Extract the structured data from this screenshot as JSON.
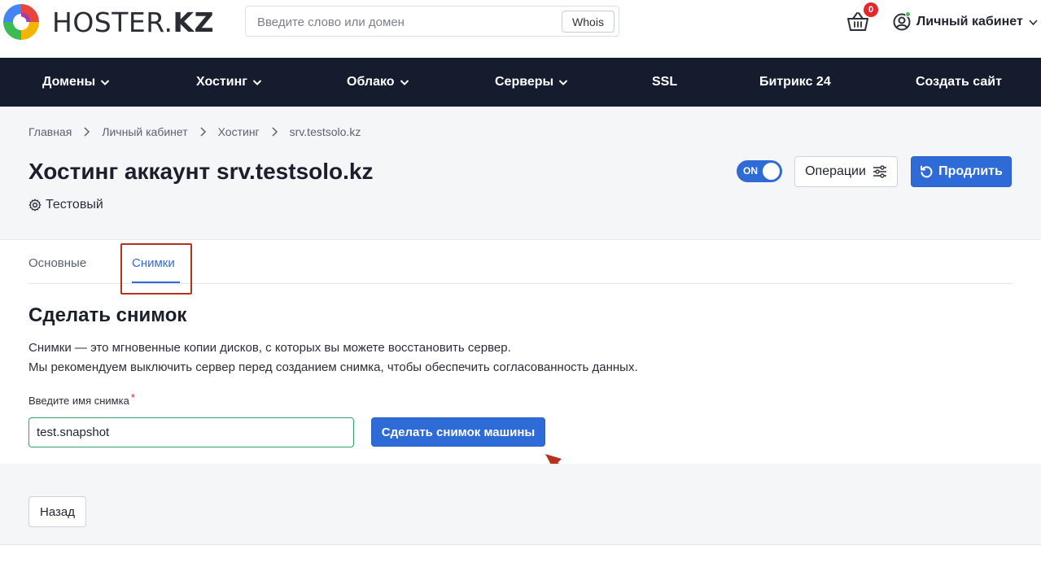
{
  "header": {
    "logo_text_light": "HOSTER.",
    "logo_text_bold": "KZ",
    "search": {
      "placeholder": "Введите слово или домен",
      "button_label": "Whois"
    },
    "cart": {
      "icon": "basket-icon",
      "count": "0"
    },
    "account": {
      "icon": "user-circle-icon",
      "label": "Личный кабинет"
    }
  },
  "nav": {
    "items": [
      {
        "label": "Домены",
        "has_dropdown": true
      },
      {
        "label": "Хостинг",
        "has_dropdown": true
      },
      {
        "label": "Облако",
        "has_dropdown": true
      },
      {
        "label": "Серверы",
        "has_dropdown": true
      },
      {
        "label": "SSL",
        "has_dropdown": false
      },
      {
        "label": "Битрикс 24",
        "has_dropdown": false
      },
      {
        "label": "Создать сайт",
        "has_dropdown": false
      }
    ]
  },
  "breadcrumb": [
    "Главная",
    "Личный кабинет",
    "Хостинг",
    "srv.testsolo.kz"
  ],
  "page": {
    "title": "Хостинг аккаунт srv.testsolo.kz",
    "plan_label": "Тестовый",
    "toggle_label": "ON",
    "operations_label": "Операции",
    "renew_label": "Продлить"
  },
  "tabs": [
    {
      "label": "Основные",
      "active": false
    },
    {
      "label": "Снимки",
      "active": true
    }
  ],
  "snapshot": {
    "title": "Сделать снимок",
    "desc_line1": "Снимки — это мгновенные копии дисков, с которых вы можете восстановить сервер.",
    "desc_line2": "Мы рекомендуем выключить сервер перед созданием снимка, чтобы обеспечить согласованность данных.",
    "field_label": "Введите имя снимка",
    "required_mark": "*",
    "field_value": "test.snapshot",
    "submit_label": "Сделать снимок машины"
  },
  "footer": {
    "back_label": "Назад"
  },
  "colors": {
    "accent": "#2f6bd6",
    "nav_bg": "#141c2d",
    "annotation": "#b5331c"
  }
}
